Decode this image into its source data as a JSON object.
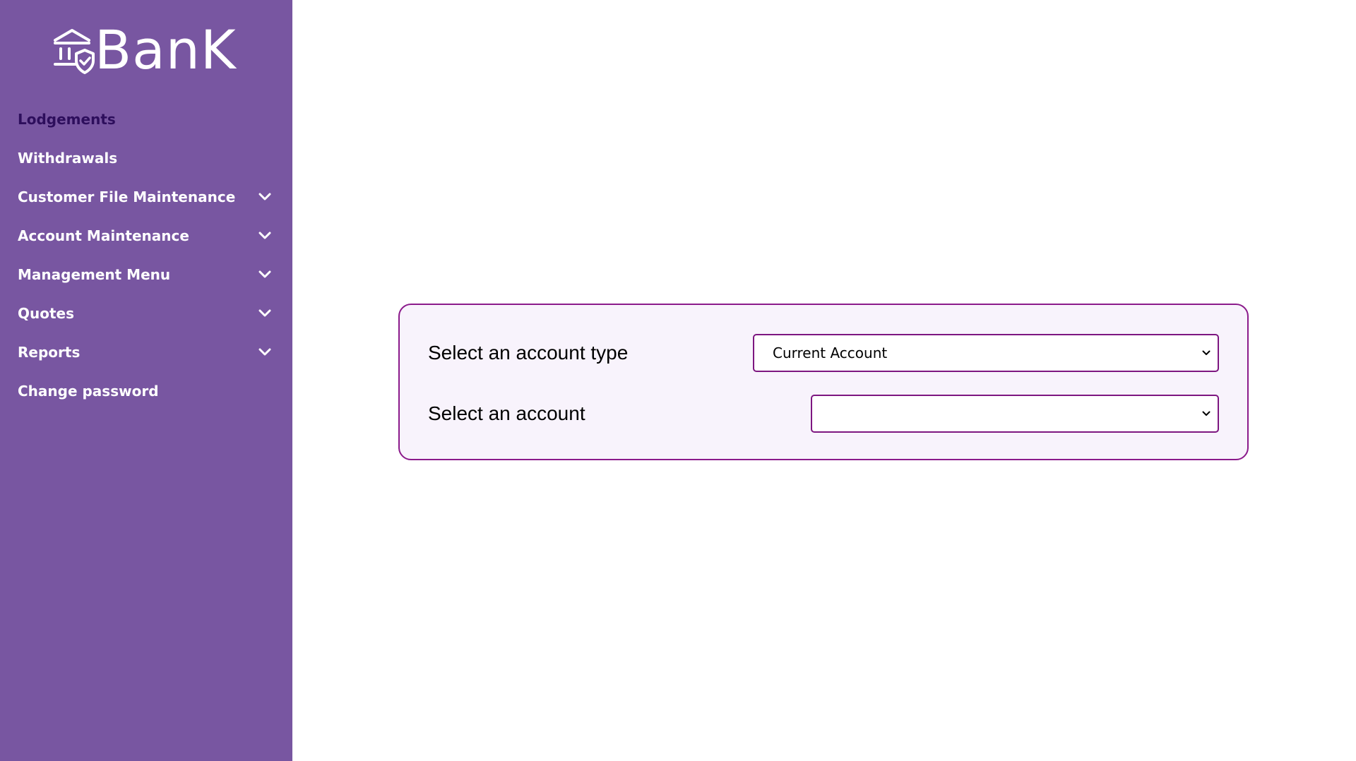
{
  "brand": {
    "name": "BanK"
  },
  "sidebar": {
    "items": [
      {
        "label": "Lodgements",
        "active": true,
        "expandable": false
      },
      {
        "label": "Withdrawals",
        "active": false,
        "expandable": false
      },
      {
        "label": "Customer File Maintenance",
        "active": false,
        "expandable": true
      },
      {
        "label": "Account Maintenance",
        "active": false,
        "expandable": true
      },
      {
        "label": "Management Menu",
        "active": false,
        "expandable": true
      },
      {
        "label": "Quotes",
        "active": false,
        "expandable": true
      },
      {
        "label": "Reports",
        "active": false,
        "expandable": true
      },
      {
        "label": "Change password",
        "active": false,
        "expandable": false
      }
    ]
  },
  "form": {
    "account_type": {
      "label": "Select an account type",
      "value": "Current Account"
    },
    "account": {
      "label": "Select an account",
      "value": ""
    }
  },
  "colors": {
    "sidebar_bg": "#7856a1",
    "active_nav_text": "#2d0e5c",
    "nav_text": "#ffffff",
    "card_bg": "#f8f3fc",
    "card_border": "#8b1a8b",
    "select_border": "#7d1680"
  },
  "icons": {
    "logo": "bank-shield-icon",
    "expand": "chevron-down-icon",
    "select_arrow": "chevron-down-icon"
  }
}
